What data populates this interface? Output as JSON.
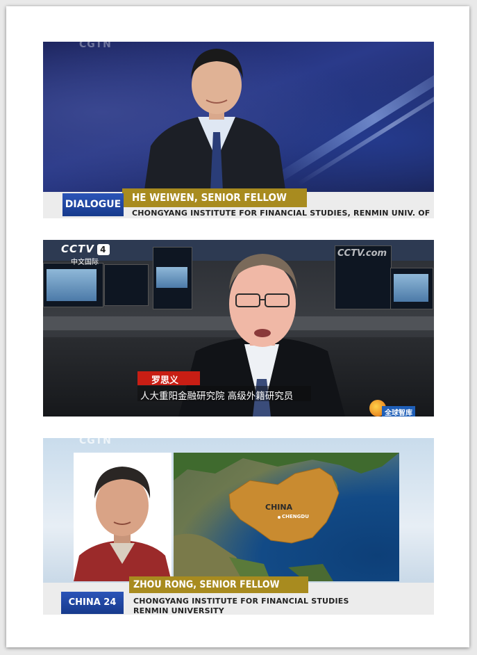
{
  "still1": {
    "watermark": "CGTN",
    "program_label": "DIALOGUE",
    "name_title": "HE WEIWEN, SENIOR FELLOW",
    "affiliation": "CHONGYANG INSTITUTE FOR FINANCIAL STUDIES, RENMIN UNIV. OF CHINA"
  },
  "still2": {
    "channel_logo": "CCTV",
    "channel_number": "4",
    "channel_name": "中文国际",
    "site_logo": "CCTV.com",
    "name": "罗思义",
    "affiliation": "人大重阳金融研究院 高级外籍研究员",
    "corner_badge": "全球智库"
  },
  "still3": {
    "watermark": "CGTN",
    "program_label": "CHINA 24",
    "name_title": "ZHOU RONG, SENIOR FELLOW",
    "affiliation_line1": "CHONGYANG INSTITUTE FOR FINANCIAL STUDIES",
    "affiliation_line2": "RENMIN UNIVERSITY",
    "map_country": "CHINA",
    "map_city": "CHENGDU"
  }
}
